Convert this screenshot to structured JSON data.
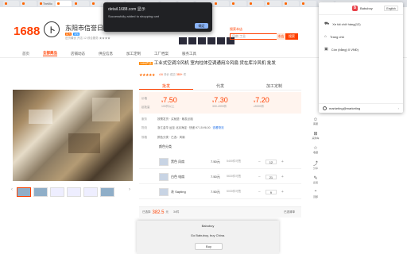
{
  "browser": {
    "tabs": [
      "",
      "",
      "TheMio",
      "",
      "",
      "",
      "",
      "",
      "",
      "",
      "",
      "",
      "",
      "",
      "",
      "",
      "",
      "",
      "",
      "",
      ""
    ],
    "active_tab_index": 3
  },
  "alert": {
    "title": "detail.1688.com 显示",
    "message": "Successfully added to shopping cart",
    "ok_label": "确定"
  },
  "header": {
    "logo": "1688",
    "seal_char": "卜",
    "shop_name": "东阳市信誉日用品有",
    "badges": [
      "实力",
      "诚信"
    ],
    "shop_info": "进货最优 开店 12 综合服务 ★★★★",
    "search_tab": "搜索本店",
    "search_placeholder": "风扇 工业",
    "search_button": "搜索",
    "search_shop_button": "本店"
  },
  "nav": {
    "items": [
      "首页",
      "全部商品",
      "店铺动态",
      "供应信息",
      "加工定制",
      "工厂档案",
      "服务工具"
    ],
    "active_index": 1
  },
  "product": {
    "tag": "1688严选",
    "title": "工业式空调冷风机 室内柱体空调通用冷风扇 货在库冷风机 批发",
    "stars": "★★★★★",
    "rating": "4.6",
    "stats": [
      "评价",
      "成交",
      "380+",
      "件"
    ],
    "price_tabs": [
      "批发",
      "代发",
      "加工定制"
    ],
    "price_label": "价格",
    "qty_label": "起批量",
    "prices": [
      {
        "value": "7.50",
        "qty": "100件以上"
      },
      {
        "value": "7.30",
        "qty": "300-4999件"
      },
      {
        "value": "7.20",
        "qty": "≥5000件"
      }
    ],
    "currency": "¥",
    "rows": [
      {
        "k": "服务",
        "v": "按需发货 · 买就退 · 晚发必赔"
      },
      {
        "k": "物流",
        "v": "浙江金华 运至 北京海淀 · 快递 ¥7.15 ¥6.00",
        "link": "查看物流"
      },
      {
        "k": "规格",
        "v": "颜色分类 · 已选：风扇"
      }
    ],
    "sku_header": "颜色分类",
    "skus": [
      {
        "name": "黑色 风扇",
        "price": "7.50元",
        "stock": "5400件可售",
        "qty": "12"
      },
      {
        "name": "白色 电扇",
        "price": "7.50元",
        "stock": "5630件可售",
        "qty": "21"
      },
      {
        "name": "灰 Sapting",
        "price": "7.50元",
        "stock": "5030件可售",
        "qty": "9"
      }
    ],
    "cart": {
      "label": "已选择",
      "total": "382.5",
      "unit": "元",
      "count": "34件",
      "selected": "已选清单"
    }
  },
  "floatbar": [
    "客服",
    "采购车",
    "收藏",
    "分享",
    "反馈",
    "顶部"
  ],
  "popup": {
    "brand": "Babuboy",
    "lang": "English",
    "items": [
      {
        "icon": "cart-icon",
        "label": "Xe tải chở hàng(12)"
      },
      {
        "icon": "home-icon",
        "label": "Trang chủ"
      },
      {
        "icon": "wallet-icon",
        "label": "Còn (bằng) 0 VNĐ)"
      }
    ],
    "user": "marketing@marketing"
  },
  "dialog": {
    "title": "Babuboy",
    "message": "Go Babuboy, buy China.",
    "ok_label": "Buy"
  }
}
